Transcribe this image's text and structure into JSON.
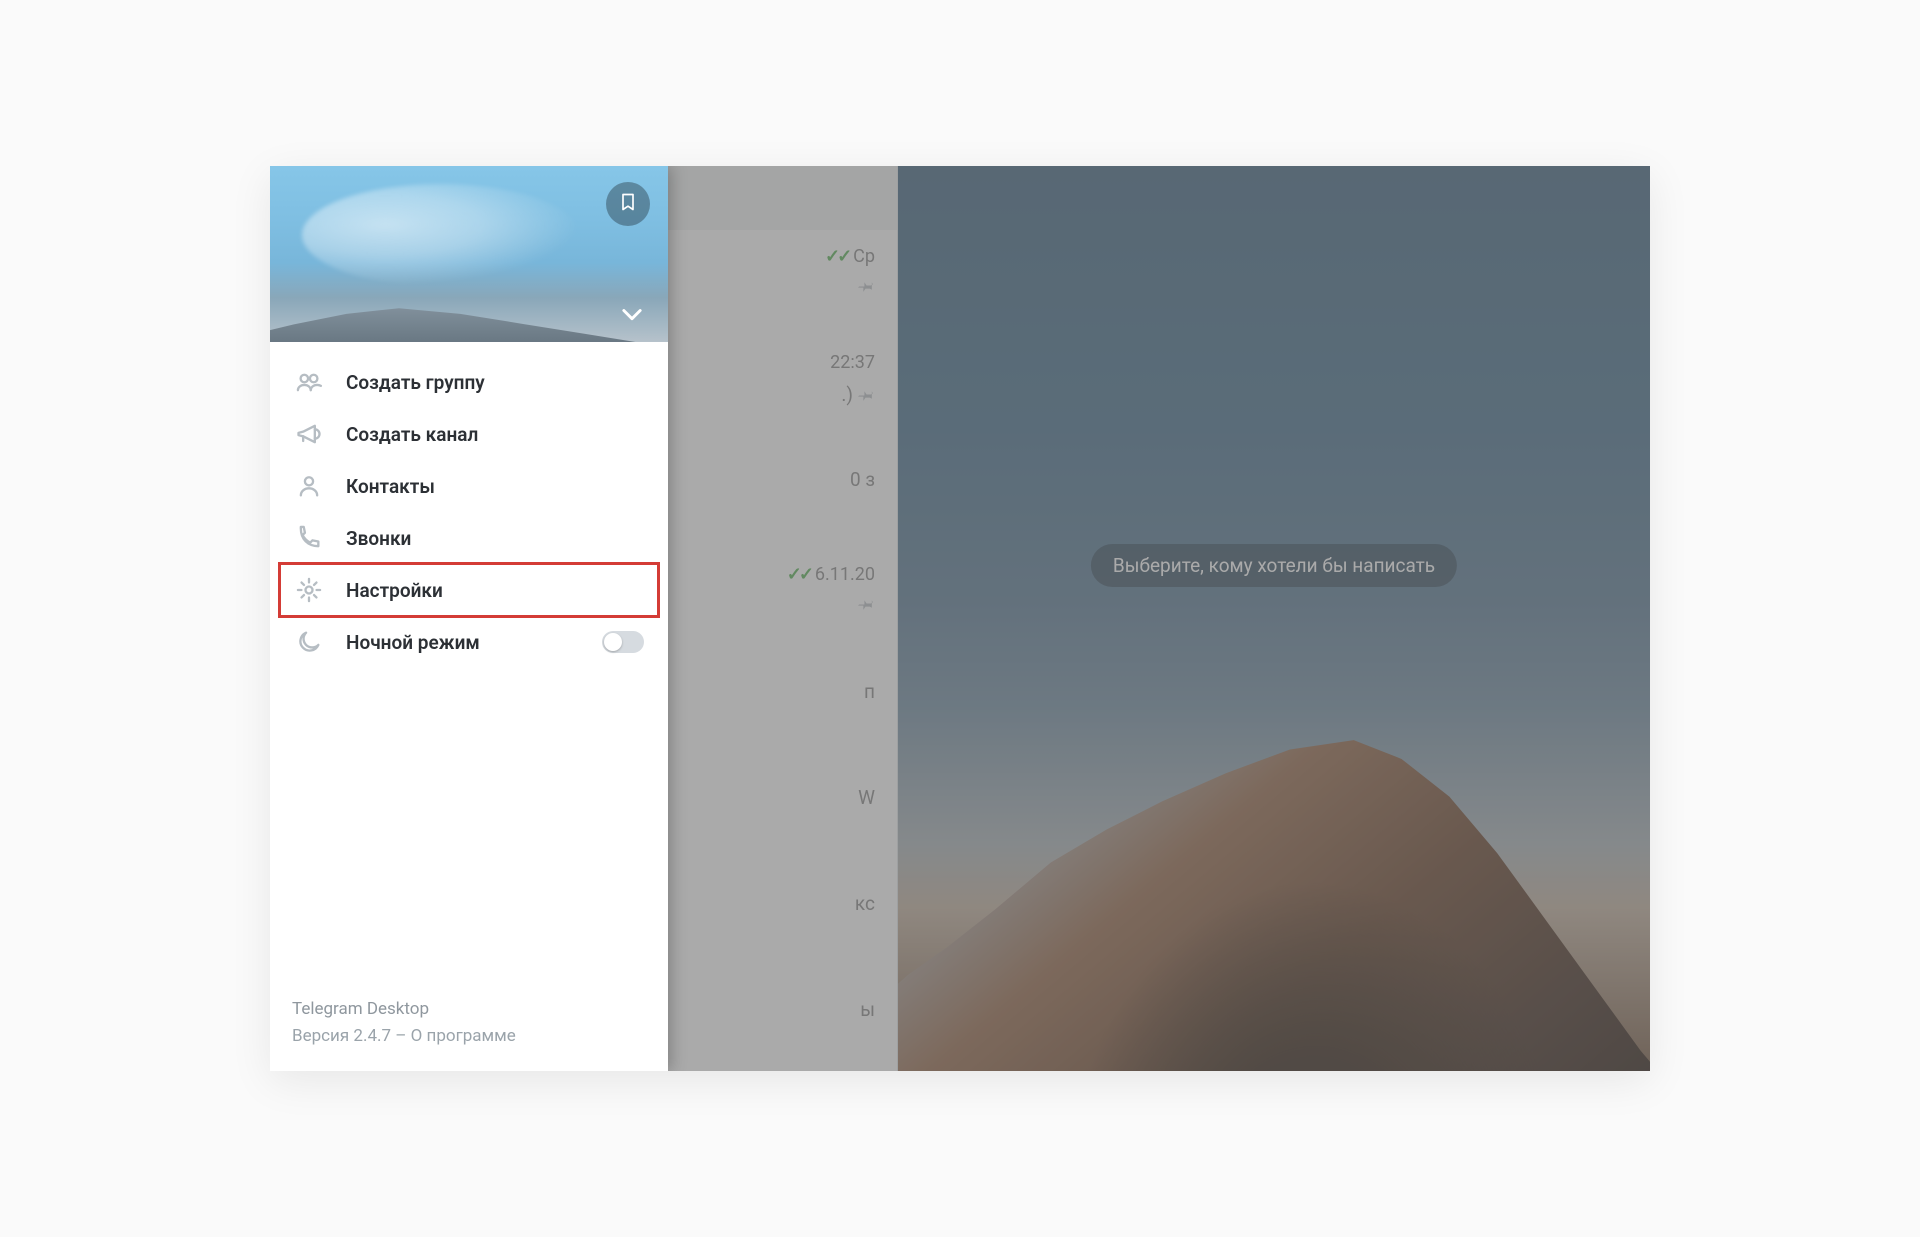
{
  "drawer": {
    "items": [
      {
        "id": "new-group",
        "label": "Создать группу"
      },
      {
        "id": "new-channel",
        "label": "Создать канал"
      },
      {
        "id": "contacts",
        "label": "Контакты"
      },
      {
        "id": "calls",
        "label": "Звонки"
      },
      {
        "id": "settings",
        "label": "Настройки",
        "highlighted": true
      },
      {
        "id": "night-mode",
        "label": "Ночной режим",
        "toggle": true,
        "toggle_on": false
      }
    ],
    "footer": {
      "app_name": "Telegram Desktop",
      "version_line": "Версия 2.4.7 – О программе"
    }
  },
  "chatlist": {
    "rows": [
      {
        "time": "Ср",
        "ticks": true,
        "pinned": true,
        "snippet_tail": ""
      },
      {
        "time": "22:37",
        "ticks": false,
        "pinned": true,
        "snippet_tail": ".)"
      },
      {
        "time": "",
        "ticks": false,
        "pinned": false,
        "snippet_tail": "0 з"
      },
      {
        "time": "6.11.20",
        "ticks": true,
        "pinned": true,
        "snippet_tail": ""
      },
      {
        "time": "",
        "ticks": false,
        "pinned": false,
        "snippet_tail": "п"
      },
      {
        "time": "",
        "ticks": false,
        "pinned": false,
        "snippet_tail": "W"
      },
      {
        "time": "",
        "ticks": false,
        "pinned": false,
        "snippet_tail": "кс"
      },
      {
        "time": "",
        "ticks": false,
        "pinned": false,
        "snippet_tail": "ы"
      }
    ]
  },
  "chat_main": {
    "empty_hint": "Выберите, кому хотели бы написать"
  }
}
